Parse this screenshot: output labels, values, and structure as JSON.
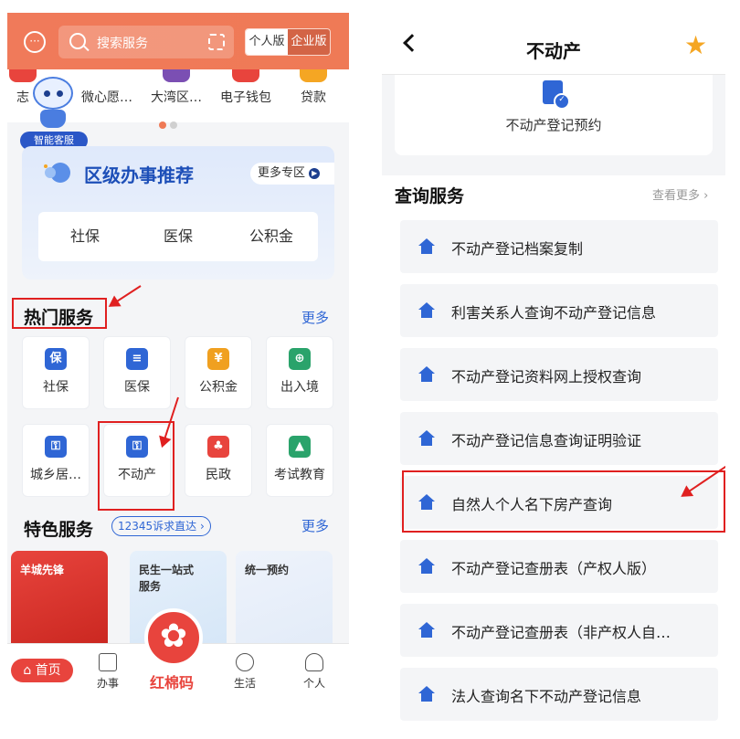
{
  "left": {
    "search": {
      "placeholder": "搜索服务"
    },
    "version_switch": {
      "personal": "个人版",
      "enterprise": "企业版"
    },
    "quick_services": [
      {
        "label": "志",
        "color": "#e8443d"
      },
      {
        "label": "微心愿…",
        "color": "#f07a5a"
      },
      {
        "label": "大湾区…",
        "color": "#7b4fb3"
      },
      {
        "label": "电子钱包",
        "color": "#e8443d"
      },
      {
        "label": "贷款",
        "color": "#f5a623"
      }
    ],
    "carousel": {
      "active_index": 0,
      "count": 2
    },
    "assistant_label": "智能客服",
    "district": {
      "title": "区级办事推荐",
      "more_label": "更多专区",
      "tabs": [
        "社保",
        "医保",
        "公积金"
      ]
    },
    "hot": {
      "title": "热门服务",
      "more_label": "更多",
      "items": [
        {
          "label": "社保",
          "icon": "shield-icon",
          "glyph": "保",
          "color": "#2f66d5"
        },
        {
          "label": "医保",
          "icon": "card-icon",
          "glyph": "≡",
          "color": "#2f66d5"
        },
        {
          "label": "公积金",
          "icon": "house-yuan-icon",
          "glyph": "¥",
          "color": "#f0a020"
        },
        {
          "label": "出入境",
          "icon": "passport-icon",
          "glyph": "⊕",
          "color": "#2aa36b"
        },
        {
          "label": "城乡居…",
          "icon": "home-key-icon",
          "glyph": "⚿",
          "color": "#2f66d5"
        },
        {
          "label": "不动产",
          "icon": "home-key-icon",
          "glyph": "⚿",
          "color": "#2f66d5"
        },
        {
          "label": "民政",
          "icon": "people-icon",
          "glyph": "♣",
          "color": "#e8443d"
        },
        {
          "label": "考试教育",
          "icon": "graduation-cap-icon",
          "glyph": "▲",
          "color": "#2aa36b"
        }
      ]
    },
    "featured": {
      "title": "特色服务",
      "badge": "12345诉求直达",
      "more_label": "更多",
      "cards": [
        {
          "label": "羊城先锋",
          "bg": "#e8443d",
          "fg": "#ffffff"
        },
        {
          "label": "民生一站式\n服务",
          "bg": "#e6f0fb",
          "fg": "#333333"
        },
        {
          "label": "统一预约",
          "bg": "#eef3fb",
          "fg": "#333333"
        }
      ]
    },
    "tabbar": {
      "home": "首页",
      "work": "办事",
      "center": "红棉码",
      "life": "生活",
      "me": "个人"
    }
  },
  "right": {
    "title": "不动产",
    "appointment_label": "不动产登记预约",
    "query": {
      "title": "查询服务",
      "more_label": "查看更多",
      "items": [
        "不动产登记档案复制",
        "利害关系人查询不动产登记信息",
        "不动产登记资料网上授权查询",
        "不动产登记信息查询证明验证",
        "自然人个人名下房产查询",
        "不动产登记查册表（产权人版）",
        "不动产登记查册表（非产权人自…",
        "法人查询名下不动产登记信息"
      ]
    }
  },
  "colors": {
    "brand_orange": "#f07a5a",
    "brand_red": "#e8443d",
    "link_blue": "#2f66d5",
    "highlight_red": "#e02020"
  }
}
